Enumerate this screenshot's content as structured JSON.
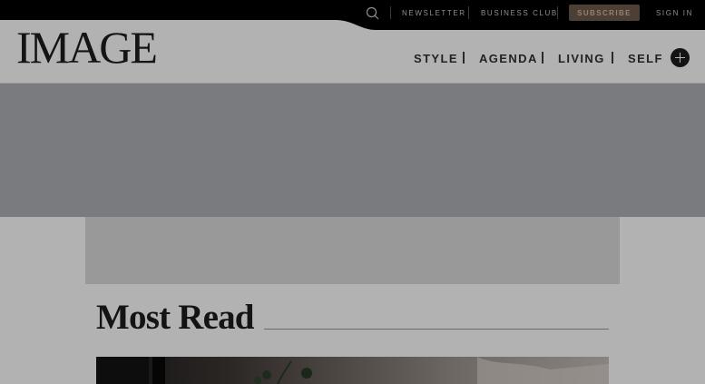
{
  "topbar": {
    "newsletter_label": "NEWSLETTER",
    "business_club_label": "BUSINESS CLUB",
    "subscribe_label": "SUBSCRIBE",
    "sign_in_label": "SIGN IN"
  },
  "header": {
    "logo_text": "IMAGE",
    "nav": [
      {
        "label": "STYLE"
      },
      {
        "label": "AGENDA"
      },
      {
        "label": "LIVING"
      },
      {
        "label": "SELF"
      }
    ]
  },
  "most_read": {
    "title": "Most Read"
  },
  "colors": {
    "topbar_bg": "#000000",
    "page_bg": "#b2b2b2",
    "ad_band": "#797b7e",
    "ad_box": "#999999",
    "subscribe_bg": "#4c3f36"
  },
  "icons": {
    "search": "search-icon",
    "more": "plus-icon"
  }
}
